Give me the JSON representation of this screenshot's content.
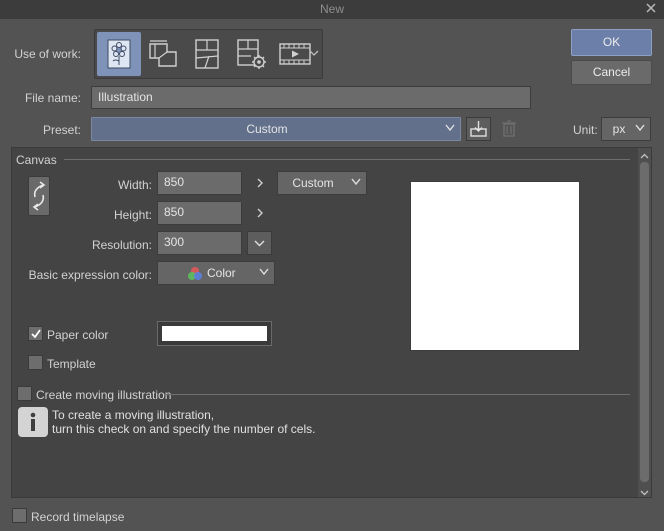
{
  "window": {
    "title": "New"
  },
  "dialog_buttons": {
    "ok": "OK",
    "cancel": "Cancel"
  },
  "use_of_work": {
    "label": "Use of work:",
    "options": [
      {
        "icon": "illustration-icon",
        "selected": true
      },
      {
        "icon": "webtoon-icon",
        "selected": false
      },
      {
        "icon": "comic-icon",
        "selected": false
      },
      {
        "icon": "comic-settings-icon",
        "selected": false
      },
      {
        "icon": "animation-icon",
        "selected": false
      }
    ]
  },
  "file_name": {
    "label": "File name:",
    "value": "Illustration"
  },
  "preset": {
    "label": "Preset:",
    "value": "Custom"
  },
  "unit": {
    "label": "Unit:",
    "value": "px"
  },
  "canvas": {
    "section_title": "Canvas",
    "width": {
      "label": "Width:",
      "value": "850"
    },
    "height": {
      "label": "Height:",
      "value": "850"
    },
    "size_preset": "Custom",
    "resolution": {
      "label": "Resolution:",
      "value": "300"
    },
    "basic_expression_color": {
      "label": "Basic expression color:",
      "value": "Color"
    },
    "paper_color": {
      "label": "Paper color",
      "checked": true,
      "color": "#ffffff"
    },
    "template": {
      "label": "Template",
      "checked": false
    }
  },
  "moving_illustration": {
    "label": "Create moving illustration",
    "checked": false,
    "info_line1": "To create a moving illustration,",
    "info_line2": "turn this check on and specify the number of cels."
  },
  "record_timelapse": {
    "label": "Record timelapse",
    "checked": false
  },
  "colors": {
    "accent": "#6b7fa8",
    "selected_work": "#7f93b8",
    "background": "#535353",
    "panel": "#444444"
  }
}
